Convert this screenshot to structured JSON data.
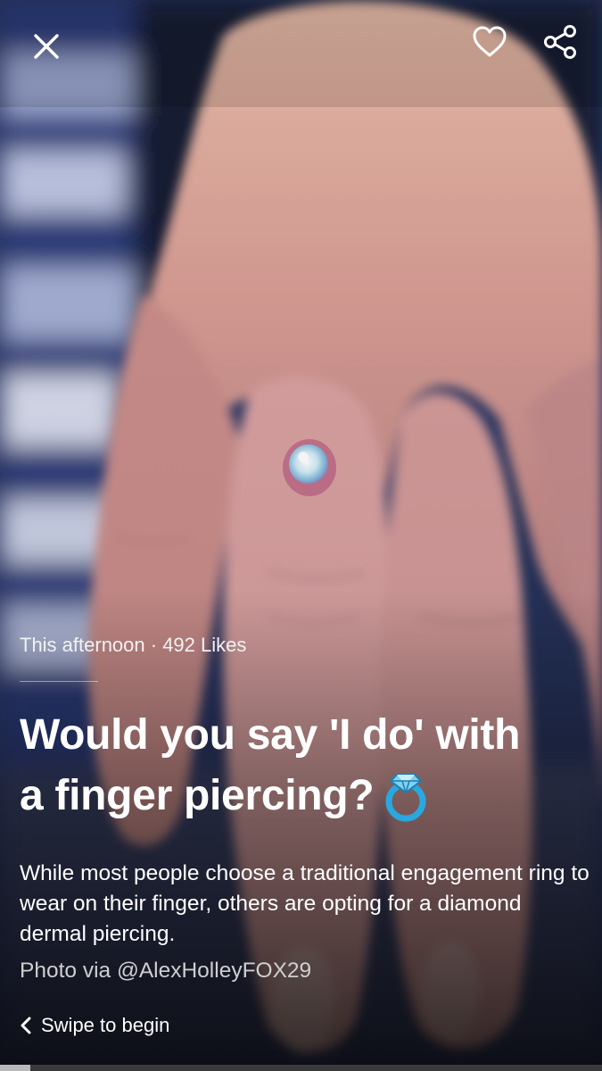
{
  "story": {
    "meta": "This afternoon · 492 Likes",
    "title_line1": "Would you say 'I do' with",
    "title_line2": "a finger piercing?",
    "title_emoji": "ring-icon",
    "description": "While most people choose a traditional engagement ring to wear on their finger, others are opting for a diamond dermal piercing.",
    "credit": "Photo via @AlexHolleyFOX29",
    "swipe_label": "Swipe to begin",
    "progress_fraction": 0.05
  },
  "toolbar": {
    "close_icon": "close-icon",
    "like_icon": "heart-icon",
    "share_icon": "share-icon"
  },
  "colors": {
    "text": "#ffffff",
    "ring_accent": "#29a8e0"
  }
}
